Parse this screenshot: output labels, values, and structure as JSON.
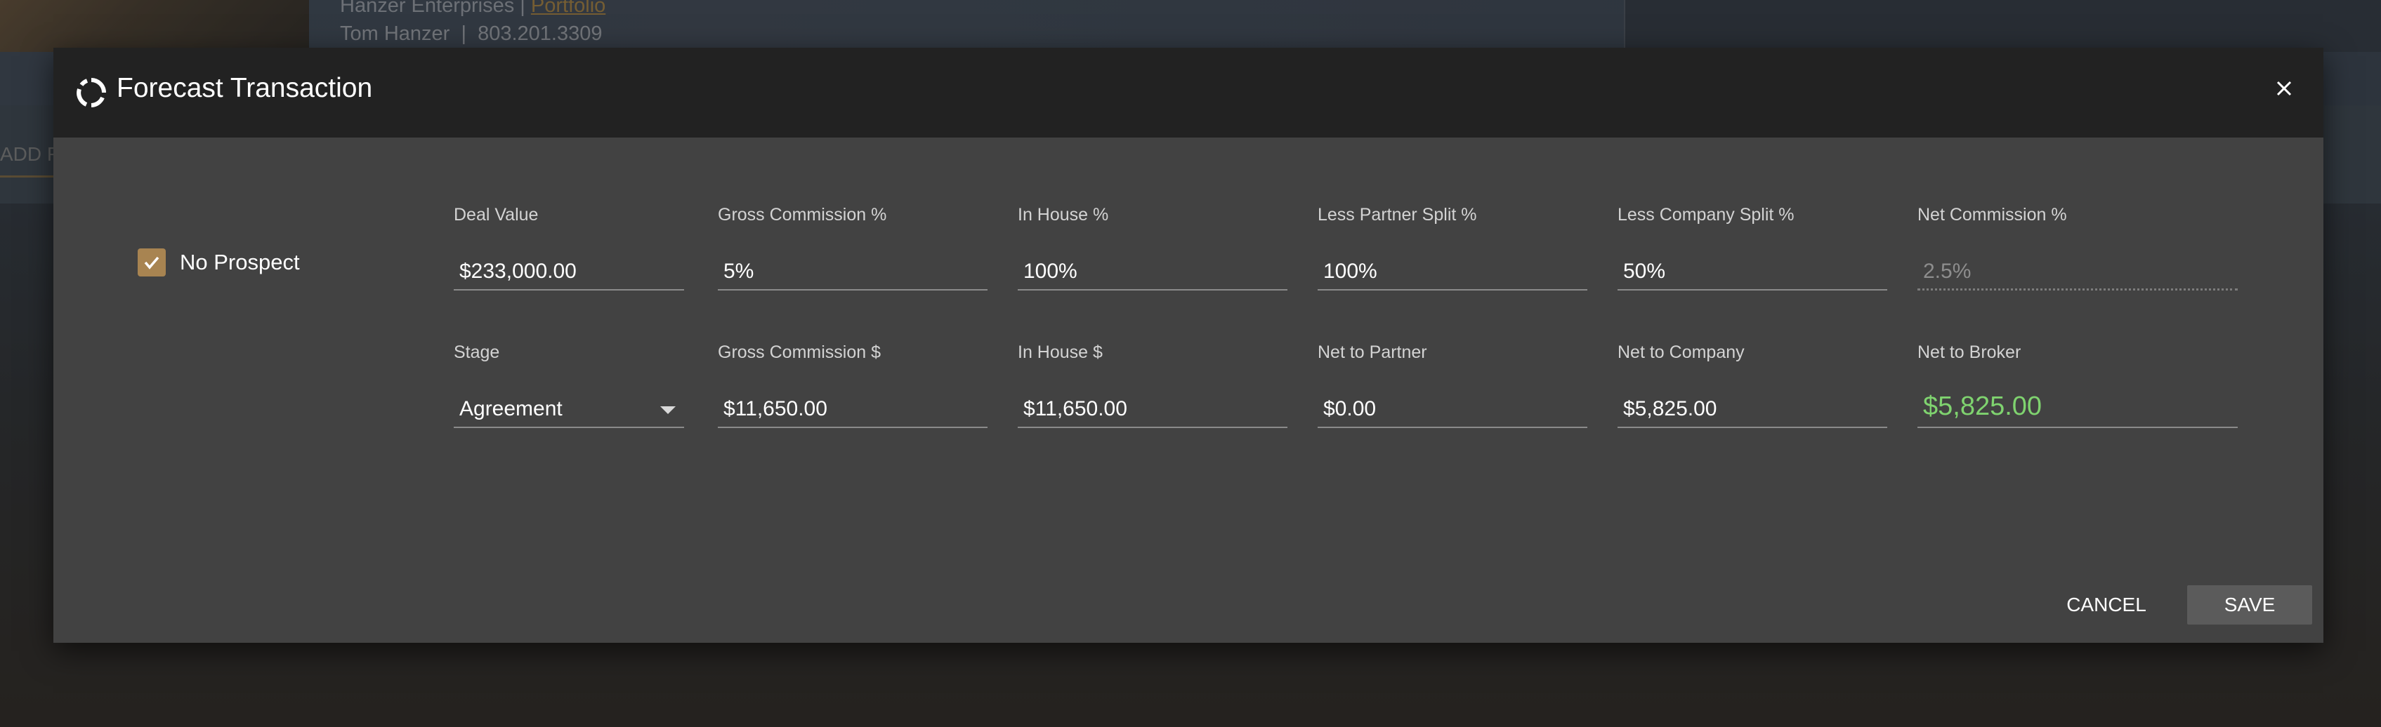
{
  "background": {
    "company": "Hanzer Enterprises |",
    "company_link": "Portfolio",
    "contact": "Tom Hanzer  |  803.201.3309",
    "add_button": "ADD F"
  },
  "modal": {
    "title": "Forecast Transaction",
    "title_icon": "loading-circle-icon",
    "close_icon": "close-icon",
    "no_prospect": {
      "label": "No Prospect",
      "checked": true
    },
    "fields_row1": [
      {
        "label": "Deal Value",
        "value": "$233,000.00"
      },
      {
        "label": "Gross Commission %",
        "value": "5%"
      },
      {
        "label": "In House %",
        "value": "100%"
      },
      {
        "label": "Less Partner Split %",
        "value": "100%"
      },
      {
        "label": "Less Company Split %",
        "value": "50%"
      },
      {
        "label": "Net Commission %",
        "value": "2.5%",
        "disabled": true
      }
    ],
    "fields_row2": [
      {
        "label": "Stage",
        "value": "Agreement",
        "type": "select"
      },
      {
        "label": "Gross Commission $",
        "value": "$11,650.00"
      },
      {
        "label": "In House $",
        "value": "$11,650.00"
      },
      {
        "label": "Net to Partner",
        "value": "$0.00"
      },
      {
        "label": "Net to Company",
        "value": "$5,825.00"
      },
      {
        "label": "Net to Broker",
        "value": "$5,825.00",
        "highlight": true
      }
    ],
    "buttons": {
      "cancel": "CANCEL",
      "save": "SAVE"
    }
  },
  "colors": {
    "accent": "#a88451",
    "success": "#7fd36f",
    "header_bg": "#222222",
    "modal_bg": "#424242"
  }
}
